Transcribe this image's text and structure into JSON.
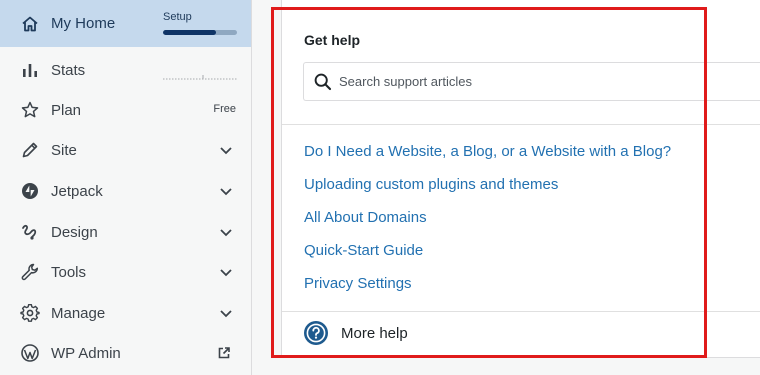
{
  "sidebar": {
    "items": [
      {
        "label": "My Home",
        "icon": "home-icon",
        "active": true
      },
      {
        "label": "Stats",
        "icon": "stats-icon"
      },
      {
        "label": "Plan",
        "icon": "star-icon",
        "badge": "Free"
      },
      {
        "label": "Site",
        "icon": "pencil-icon",
        "expandable": true
      },
      {
        "label": "Jetpack",
        "icon": "jetpack-icon",
        "expandable": true
      },
      {
        "label": "Design",
        "icon": "brush-icon",
        "expandable": true
      },
      {
        "label": "Tools",
        "icon": "wrench-icon",
        "expandable": true
      },
      {
        "label": "Manage",
        "icon": "gear-icon",
        "expandable": true
      },
      {
        "label": "WP Admin",
        "icon": "wordpress-icon",
        "external": true
      }
    ],
    "setup": {
      "label": "Setup",
      "progress": 0.72
    },
    "colors": {
      "active_bg": "#c5d9ed",
      "active_text": "#1e3a5a",
      "progress_fill": "#0f3466"
    }
  },
  "help": {
    "title": "Get help",
    "search": {
      "placeholder": "Search support articles",
      "value": ""
    },
    "links": [
      "Do I Need a Website, a Blog, or a Website with a Blog?",
      "Uploading custom plugins and themes",
      "All About Domains",
      "Quick-Start Guide",
      "Privacy Settings"
    ],
    "more_help": "More help",
    "colors": {
      "link": "#2271b1",
      "highlight": "#e01b1b",
      "more_help_icon": "#1e5a8e"
    }
  }
}
